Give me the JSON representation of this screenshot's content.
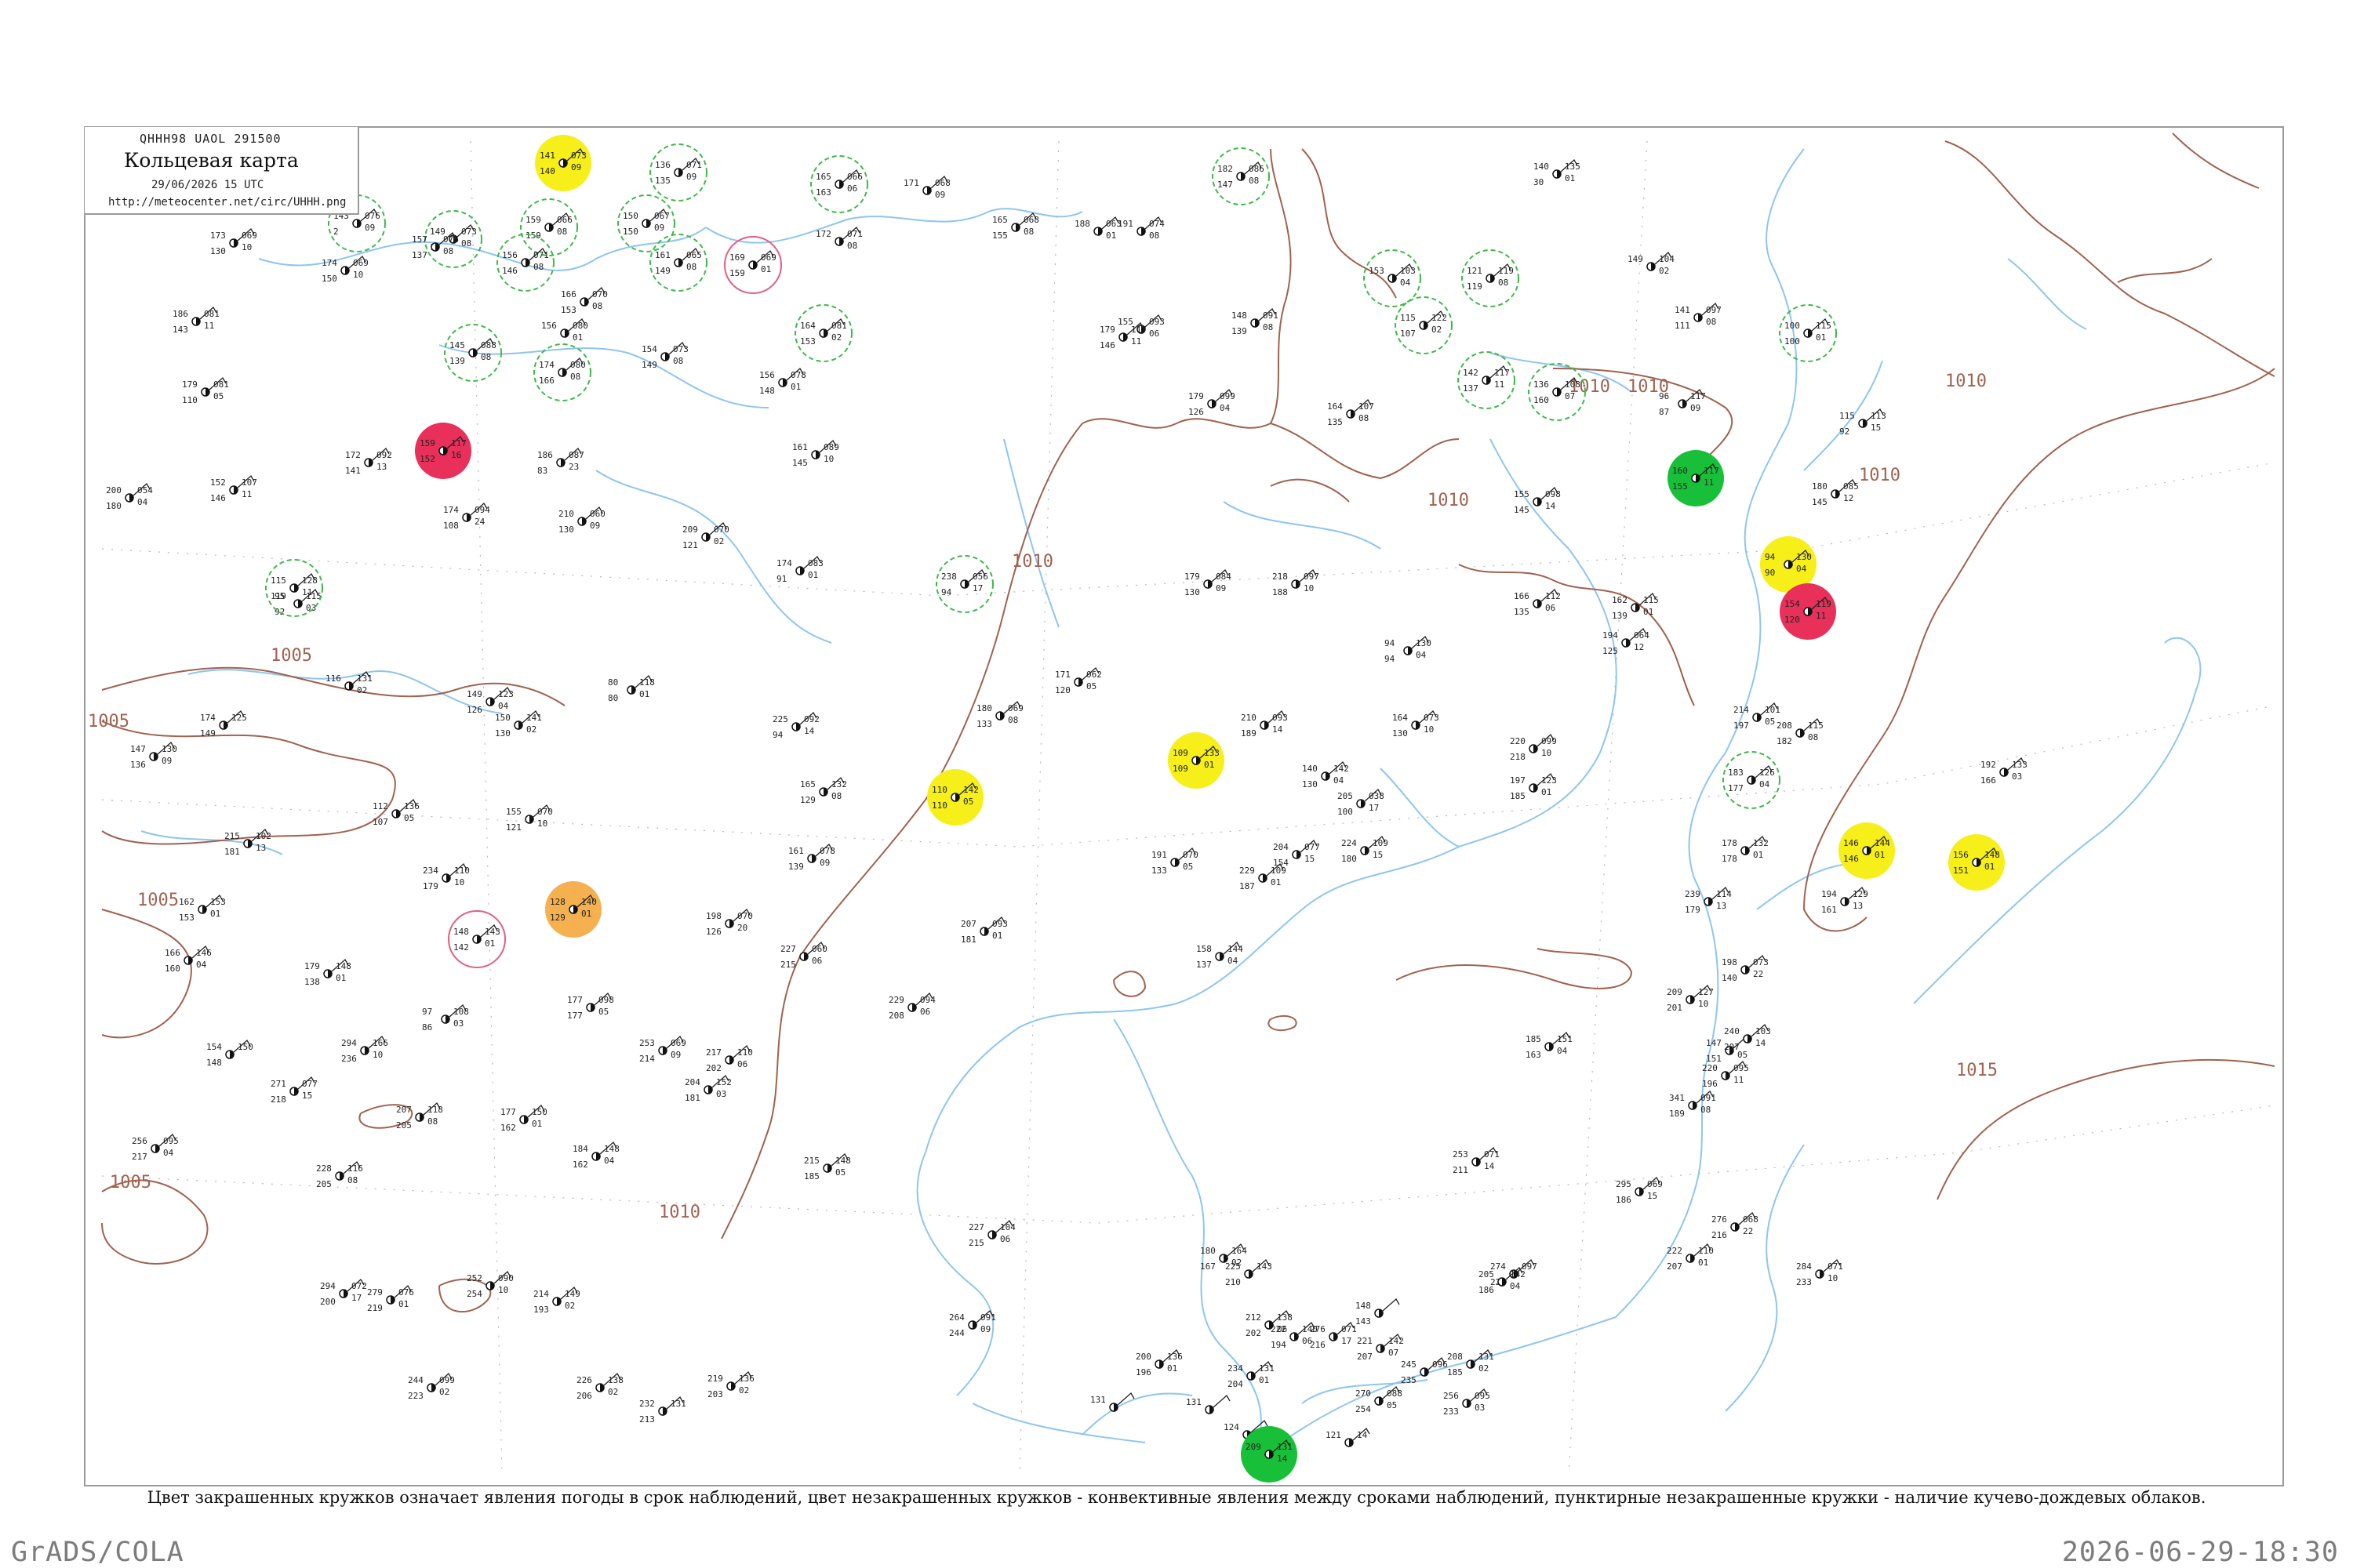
{
  "header": {
    "code": "QHHH98  UAOL  291500",
    "title": "Кольцевая карта",
    "date": "29/06/2026 15 UTC",
    "url": "http://meteocenter.net/circ/UHHH.png"
  },
  "caption": "Цвет закрашенных кружков означает явления погоды в срок наблюдений, цвет незакрашенных кружков - конвективные явления между сроками наблюдений, пунктирные незакрашенные кружки - наличие кучево-дождевых облаков.",
  "footer": {
    "left": "GrADS/COLA",
    "right": "2026-06-29-18:30"
  },
  "colors": {
    "isobar": "#a0624f",
    "coast": "#8ec5f0",
    "border": "#9a9a9a",
    "cb_circle": "#3fb84a",
    "thunder_circle": "#e06080",
    "fill_yellow": "#f6ef1a",
    "fill_red": "#e8305a",
    "fill_green": "#18c03a",
    "fill_orange": "#f5b050"
  },
  "isobar_labels": [
    {
      "text": "1005"
    },
    {
      "text": "1005"
    },
    {
      "text": "1005"
    },
    {
      "text": "1005"
    },
    {
      "text": "1010"
    },
    {
      "text": "1010"
    },
    {
      "text": "1010"
    },
    {
      "text": "1010"
    },
    {
      "text": "1010"
    },
    {
      "text": "1010"
    },
    {
      "text": "1010"
    },
    {
      "text": "1015"
    }
  ],
  "stations": [
    {
      "t": "143",
      "p": "076",
      "d": "09",
      "v": "2",
      "mark": "cb"
    },
    {
      "t": "149",
      "p": "073",
      "d": "08",
      "v": "1",
      "mark": "cb"
    },
    {
      "t": "141",
      "p": "073",
      "d": "09",
      "v": "140",
      "mark": "yellow"
    },
    {
      "t": "136",
      "p": "071",
      "d": "09",
      "v": "135",
      "mark": "cb"
    },
    {
      "t": "165",
      "p": "066",
      "d": "06",
      "v": "163",
      "mark": "cb"
    },
    {
      "t": "171",
      "p": "068",
      "d": "09",
      "v": "",
      "mark": "none"
    },
    {
      "t": "182",
      "p": "086",
      "d": "08",
      "v": "147",
      "mark": "cb"
    },
    {
      "t": "140",
      "p": "135",
      "d": "01",
      "v": "30",
      "mark": "none"
    },
    {
      "t": "173",
      "p": "069",
      "d": "10",
      "v": "130",
      "mark": "none"
    },
    {
      "t": "157",
      "p": "076",
      "d": "08",
      "v": "137",
      "mark": "none"
    },
    {
      "t": "159",
      "p": "066",
      "d": "08",
      "v": "159",
      "mark": "cb"
    },
    {
      "t": "150",
      "p": "067",
      "d": "09",
      "v": "150",
      "mark": "cb"
    },
    {
      "t": "169",
      "p": "069",
      "d": "01",
      "v": "159",
      "mark": "thunder"
    },
    {
      "t": "172",
      "p": "071",
      "d": "08",
      "v": "",
      "mark": "none"
    },
    {
      "t": "165",
      "p": "068",
      "d": "08",
      "v": "155",
      "mark": "none"
    },
    {
      "t": "188",
      "p": "063",
      "d": "01",
      "v": "",
      "mark": "none"
    },
    {
      "t": "191",
      "p": "074",
      "d": "08",
      "v": "",
      "mark": "none"
    },
    {
      "t": "149",
      "p": "104",
      "d": "02",
      "v": "",
      "mark": "none"
    },
    {
      "t": "174",
      "p": "069",
      "d": "10",
      "v": "150",
      "mark": "none"
    },
    {
      "t": "156",
      "p": "071",
      "d": "08",
      "v": "146",
      "mark": "cb"
    },
    {
      "t": "161",
      "p": "065",
      "d": "08",
      "v": "149",
      "mark": "cb"
    },
    {
      "t": "153",
      "p": "103",
      "d": "04",
      "v": "",
      "mark": "cb"
    },
    {
      "t": "121",
      "p": "119",
      "d": "08",
      "v": "119",
      "mark": "cb"
    },
    {
      "t": "186",
      "p": "081",
      "d": "11",
      "v": "143",
      "mark": "none"
    },
    {
      "t": "166",
      "p": "070",
      "d": "08",
      "v": "153",
      "mark": "none"
    },
    {
      "t": "156",
      "p": "080",
      "d": "01",
      "v": "",
      "mark": "none"
    },
    {
      "t": "154",
      "p": "073",
      "d": "08",
      "v": "149",
      "mark": "none"
    },
    {
      "t": "164",
      "p": "081",
      "d": "02",
      "v": "153",
      "mark": "cb"
    },
    {
      "t": "155",
      "p": "093",
      "d": "06",
      "v": "",
      "mark": "none"
    },
    {
      "t": "148",
      "p": "091",
      "d": "08",
      "v": "139",
      "mark": "none"
    },
    {
      "t": "115",
      "p": "122",
      "d": "02",
      "v": "107",
      "mark": "cb"
    },
    {
      "t": "141",
      "p": "097",
      "d": "08",
      "v": "111",
      "mark": "none"
    },
    {
      "t": "100",
      "p": "115",
      "d": "01",
      "v": "100",
      "mark": "cb"
    },
    {
      "t": "145",
      "p": "088",
      "d": "08",
      "v": "139",
      "mark": "cb"
    },
    {
      "t": "174",
      "p": "080",
      "d": "08",
      "v": "166",
      "mark": "cb"
    },
    {
      "t": "179",
      "p": "081",
      "d": "05",
      "v": "110",
      "mark": "none"
    },
    {
      "t": "156",
      "p": "078",
      "d": "01",
      "v": "148",
      "mark": "none"
    },
    {
      "t": "179",
      "p": "117",
      "d": "11",
      "v": "146",
      "mark": "none"
    },
    {
      "t": "142",
      "p": "117",
      "d": "11",
      "v": "137",
      "mark": "cb"
    },
    {
      "t": "136",
      "p": "108",
      "d": "07",
      "v": "160",
      "mark": "cb"
    },
    {
      "t": "96",
      "p": "117",
      "d": "09",
      "v": "87",
      "mark": "none"
    },
    {
      "t": "115",
      "p": "113",
      "d": "15",
      "v": "92",
      "mark": "none"
    },
    {
      "t": "161",
      "p": "089",
      "d": "10",
      "v": "145",
      "mark": "none"
    },
    {
      "t": "179",
      "p": "099",
      "d": "04",
      "v": "126",
      "mark": "none"
    },
    {
      "t": "164",
      "p": "107",
      "d": "08",
      "v": "135",
      "mark": "none"
    },
    {
      "t": "172",
      "p": "092",
      "d": "13",
      "v": "141",
      "mark": "none"
    },
    {
      "t": "159",
      "p": "117",
      "d": "16",
      "v": "152",
      "mark": "red"
    },
    {
      "t": "200",
      "p": "054",
      "d": "04",
      "v": "180",
      "mark": "none"
    },
    {
      "t": "152",
      "p": "107",
      "d": "11",
      "v": "146",
      "mark": "none"
    },
    {
      "t": "186",
      "p": "087",
      "d": "23",
      "v": "83",
      "mark": "none"
    },
    {
      "t": "174",
      "p": "094",
      "d": "24",
      "v": "108",
      "mark": "none"
    },
    {
      "t": "210",
      "p": "060",
      "d": "09",
      "v": "130",
      "mark": "none"
    },
    {
      "t": "209",
      "p": "070",
      "d": "02",
      "v": "121",
      "mark": "none"
    },
    {
      "t": "174",
      "p": "083",
      "d": "01",
      "v": "91",
      "mark": "none"
    },
    {
      "t": "155",
      "p": "098",
      "d": "14",
      "v": "145",
      "mark": "none"
    },
    {
      "t": "180",
      "p": "085",
      "d": "12",
      "v": "145",
      "mark": "none"
    },
    {
      "t": "160",
      "p": "117",
      "d": "11",
      "v": "155",
      "mark": "green"
    },
    {
      "t": "94",
      "p": "130",
      "d": "04",
      "v": "90",
      "mark": "yellow"
    },
    {
      "t": "95",
      "p": "115",
      "d": "03",
      "v": "92",
      "mark": "none"
    },
    {
      "t": "115",
      "p": "128",
      "d": "11",
      "v": "119",
      "mark": "cb"
    },
    {
      "t": "238",
      "p": "056",
      "d": "17",
      "v": "94",
      "mark": "cb"
    },
    {
      "t": "179",
      "p": "084",
      "d": "09",
      "v": "130",
      "mark": "none"
    },
    {
      "t": "218",
      "p": "097",
      "d": "10",
      "v": "188",
      "mark": "none"
    },
    {
      "t": "166",
      "p": "112",
      "d": "06",
      "v": "135",
      "mark": "none"
    },
    {
      "t": "162",
      "p": "115",
      "d": "01",
      "v": "139",
      "mark": "none"
    },
    {
      "t": "154",
      "p": "119",
      "d": "11",
      "v": "120",
      "mark": "red"
    },
    {
      "t": "116",
      "p": "131",
      "d": "02",
      "v": "",
      "mark": "none"
    },
    {
      "t": "94",
      "p": "130",
      "d": "04",
      "v": "94",
      "mark": "none"
    },
    {
      "t": "194",
      "p": "064",
      "d": "12",
      "v": "125",
      "mark": "none"
    },
    {
      "t": "149",
      "p": "123",
      "d": "04",
      "v": "126",
      "mark": "none"
    },
    {
      "t": "80",
      "p": "118",
      "d": "01",
      "v": "80",
      "mark": "none"
    },
    {
      "t": "171",
      "p": "062",
      "d": "05",
      "v": "120",
      "mark": "none"
    },
    {
      "t": "164",
      "p": "073",
      "d": "10",
      "v": "130",
      "mark": "none"
    },
    {
      "t": "214",
      "p": "101",
      "d": "05",
      "v": "197",
      "mark": "none"
    },
    {
      "t": "174",
      "p": "125",
      "d": "",
      "v": "149",
      "mark": "none"
    },
    {
      "t": "150",
      "p": "141",
      "d": "02",
      "v": "130",
      "mark": "none"
    },
    {
      "t": "225",
      "p": "092",
      "d": "14",
      "v": "94",
      "mark": "none"
    },
    {
      "t": "180",
      "p": "069",
      "d": "08",
      "v": "133",
      "mark": "none"
    },
    {
      "t": "210",
      "p": "093",
      "d": "14",
      "v": "189",
      "mark": "none"
    },
    {
      "t": "220",
      "p": "099",
      "d": "10",
      "v": "218",
      "mark": "none"
    },
    {
      "t": "208",
      "p": "115",
      "d": "08",
      "v": "182",
      "mark": "none"
    },
    {
      "t": "147",
      "p": "130",
      "d": "09",
      "v": "136",
      "mark": "none"
    },
    {
      "t": "109",
      "p": "133",
      "d": "01",
      "v": "109",
      "mark": "yellow"
    },
    {
      "t": "140",
      "p": "142",
      "d": "04",
      "v": "130",
      "mark": "none"
    },
    {
      "t": "205",
      "p": "038",
      "d": "17",
      "v": "100",
      "mark": "none"
    },
    {
      "t": "197",
      "p": "123",
      "d": "01",
      "v": "185",
      "mark": "none"
    },
    {
      "t": "183",
      "p": "126",
      "d": "04",
      "v": "177",
      "mark": "cb"
    },
    {
      "t": "192",
      "p": "133",
      "d": "03",
      "v": "166",
      "mark": "none"
    },
    {
      "t": "112",
      "p": "136",
      "d": "05",
      "v": "107",
      "mark": "none"
    },
    {
      "t": "165",
      "p": "132",
      "d": "08",
      "v": "129",
      "mark": "none"
    },
    {
      "t": "110",
      "p": "142",
      "d": "05",
      "v": "110",
      "mark": "yellow"
    },
    {
      "t": "155",
      "p": "070",
      "d": "10",
      "v": "121",
      "mark": "none"
    },
    {
      "t": "215",
      "p": "102",
      "d": "13",
      "v": "181",
      "mark": "none"
    },
    {
      "t": "234",
      "p": "110",
      "d": "10",
      "v": "179",
      "mark": "none"
    },
    {
      "t": "161",
      "p": "078",
      "d": "09",
      "v": "139",
      "mark": "none"
    },
    {
      "t": "191",
      "p": "070",
      "d": "05",
      "v": "133",
      "mark": "none"
    },
    {
      "t": "204",
      "p": "077",
      "d": "15",
      "v": "154",
      "mark": "none"
    },
    {
      "t": "224",
      "p": "109",
      "d": "15",
      "v": "180",
      "mark": "none"
    },
    {
      "t": "178",
      "p": "132",
      "d": "01",
      "v": "178",
      "mark": "none"
    },
    {
      "t": "146",
      "p": "144",
      "d": "01",
      "v": "146",
      "mark": "yellow"
    },
    {
      "t": "156",
      "p": "148",
      "d": "01",
      "v": "151",
      "mark": "yellow"
    },
    {
      "t": "162",
      "p": "153",
      "d": "01",
      "v": "153",
      "mark": "none"
    },
    {
      "t": "148",
      "p": "143",
      "d": "01",
      "v": "142",
      "mark": "thunder"
    },
    {
      "t": "128",
      "p": "140",
      "d": "01",
      "v": "129",
      "mark": "orange"
    },
    {
      "t": "198",
      "p": "070",
      "d": "20",
      "v": "126",
      "mark": "none"
    },
    {
      "t": "227",
      "p": "060",
      "d": "06",
      "v": "215",
      "mark": "none"
    },
    {
      "t": "207",
      "p": "093",
      "d": "01",
      "v": "181",
      "mark": "none"
    },
    {
      "t": "229",
      "p": "109",
      "d": "01",
      "v": "187",
      "mark": "none"
    },
    {
      "t": "239",
      "p": "114",
      "d": "13",
      "v": "179",
      "mark": "none"
    },
    {
      "t": "194",
      "p": "129",
      "d": "13",
      "v": "161",
      "mark": "none"
    },
    {
      "t": "166",
      "p": "146",
      "d": "04",
      "v": "160",
      "mark": "none"
    },
    {
      "t": "179",
      "p": "148",
      "d": "01",
      "v": "138",
      "mark": "none"
    },
    {
      "t": "158",
      "p": "144",
      "d": "04",
      "v": "137",
      "mark": "none"
    },
    {
      "t": "198",
      "p": "073",
      "d": "22",
      "v": "140",
      "mark": "none"
    },
    {
      "t": "97",
      "p": "108",
      "d": "03",
      "v": "86",
      "mark": "none"
    },
    {
      "t": "177",
      "p": "098",
      "d": "05",
      "v": "177",
      "mark": "none"
    },
    {
      "t": "229",
      "p": "094",
      "d": "06",
      "v": "208",
      "mark": "none"
    },
    {
      "t": "209",
      "p": "127",
      "d": "10",
      "v": "201",
      "mark": "none"
    },
    {
      "t": "154",
      "p": "150",
      "d": "",
      "v": "148",
      "mark": "none"
    },
    {
      "t": "294",
      "p": "166",
      "d": "10",
      "v": "236",
      "mark": "none"
    },
    {
      "t": "271",
      "p": "077",
      "d": "15",
      "v": "218",
      "mark": "none"
    },
    {
      "t": "253",
      "p": "069",
      "d": "09",
      "v": "214",
      "mark": "none"
    },
    {
      "t": "217",
      "p": "110",
      "d": "06",
      "v": "202",
      "mark": "none"
    },
    {
      "t": "185",
      "p": "151",
      "d": "04",
      "v": "163",
      "mark": "none"
    },
    {
      "t": "147",
      "p": "",
      "d": "05",
      "v": "151",
      "mark": "none"
    },
    {
      "t": "240",
      "p": "103",
      "d": "14",
      "v": "207",
      "mark": "none"
    },
    {
      "t": "207",
      "p": "118",
      "d": "08",
      "v": "205",
      "mark": "none"
    },
    {
      "t": "177",
      "p": "150",
      "d": "01",
      "v": "162",
      "mark": "none"
    },
    {
      "t": "204",
      "p": "152",
      "d": "03",
      "v": "181",
      "mark": "none"
    },
    {
      "t": "341",
      "p": "091",
      "d": "08",
      "v": "189",
      "mark": "none"
    },
    {
      "t": "220",
      "p": "095",
      "d": "11",
      "v": "196",
      "mark": "none"
    },
    {
      "t": "256",
      "p": "095",
      "d": "04",
      "v": "217",
      "mark": "none"
    },
    {
      "t": "228",
      "p": "116",
      "d": "08",
      "v": "205",
      "mark": "none"
    },
    {
      "t": "184",
      "p": "148",
      "d": "04",
      "v": "162",
      "mark": "none"
    },
    {
      "t": "215",
      "p": "148",
      "d": "05",
      "v": "185",
      "mark": "none"
    },
    {
      "t": "253",
      "p": "071",
      "d": "14",
      "v": "211",
      "mark": "none"
    },
    {
      "t": "295",
      "p": "069",
      "d": "15",
      "v": "186",
      "mark": "none"
    },
    {
      "t": "227",
      "p": "104",
      "d": "06",
      "v": "215",
      "mark": "none"
    },
    {
      "t": "222",
      "p": "110",
      "d": "01",
      "v": "207",
      "mark": "none"
    },
    {
      "t": "180",
      "p": "164",
      "d": "02",
      "v": "167",
      "mark": "none"
    },
    {
      "t": "225",
      "p": "143",
      "d": "",
      "v": "210",
      "mark": "none"
    },
    {
      "t": "274",
      "p": "097",
      "d": "",
      "v": "224",
      "mark": "none"
    },
    {
      "t": "276",
      "p": "068",
      "d": "22",
      "v": "216",
      "mark": "none"
    },
    {
      "t": "294",
      "p": "072",
      "d": "17",
      "v": "200",
      "mark": "none"
    },
    {
      "t": "279",
      "p": "076",
      "d": "01",
      "v": "219",
      "mark": "none"
    },
    {
      "t": "252",
      "p": "090",
      "d": "10",
      "v": "254",
      "mark": "none"
    },
    {
      "t": "214",
      "p": "149",
      "d": "02",
      "v": "193",
      "mark": "none"
    },
    {
      "t": "222",
      "p": "140",
      "d": "06",
      "v": "194",
      "mark": "none"
    },
    {
      "t": "205",
      "p": "142",
      "d": "04",
      "v": "186",
      "mark": "none"
    },
    {
      "t": "148",
      "p": "",
      "d": "",
      "v": "143",
      "mark": "none"
    },
    {
      "t": "284",
      "p": "071",
      "d": "10",
      "v": "233",
      "mark": "none"
    },
    {
      "t": "264",
      "p": "091",
      "d": "09",
      "v": "244",
      "mark": "none"
    },
    {
      "t": "244",
      "p": "099",
      "d": "02",
      "v": "223",
      "mark": "none"
    },
    {
      "t": "226",
      "p": "138",
      "d": "02",
      "v": "206",
      "mark": "none"
    },
    {
      "t": "219",
      "p": "136",
      "d": "02",
      "v": "203",
      "mark": "none"
    },
    {
      "t": "221",
      "p": "142",
      "d": "07",
      "v": "207",
      "mark": "none"
    },
    {
      "t": "276",
      "p": "071",
      "d": "17",
      "v": "216",
      "mark": "none"
    },
    {
      "t": "245",
      "p": "096",
      "d": "",
      "v": "235",
      "mark": "none"
    },
    {
      "t": "200",
      "p": "136",
      "d": "01",
      "v": "196",
      "mark": "none"
    },
    {
      "t": "234",
      "p": "131",
      "d": "01",
      "v": "204",
      "mark": "none"
    },
    {
      "t": "208",
      "p": "131",
      "d": "02",
      "v": "185",
      "mark": "none"
    },
    {
      "t": "212",
      "p": "138",
      "d": "06",
      "v": "202",
      "mark": "none"
    },
    {
      "t": "256",
      "p": "095",
      "d": "03",
      "v": "233",
      "mark": "none"
    },
    {
      "t": "270",
      "p": "088",
      "d": "05",
      "v": "254",
      "mark": "none"
    },
    {
      "t": "232",
      "p": "131",
      "d": "",
      "v": "213",
      "mark": "none"
    },
    {
      "t": "131",
      "p": "",
      "d": "",
      "v": "",
      "mark": "none"
    },
    {
      "t": "131",
      "p": "",
      "d": "",
      "v": "",
      "mark": "none"
    },
    {
      "t": "124",
      "p": "",
      "d": "",
      "v": "",
      "mark": "none"
    },
    {
      "t": "121",
      "p": "14",
      "d": "",
      "v": "",
      "mark": "none"
    },
    {
      "t": "209",
      "p": "131",
      "d": "14",
      "v": "",
      "mark": "green"
    }
  ]
}
